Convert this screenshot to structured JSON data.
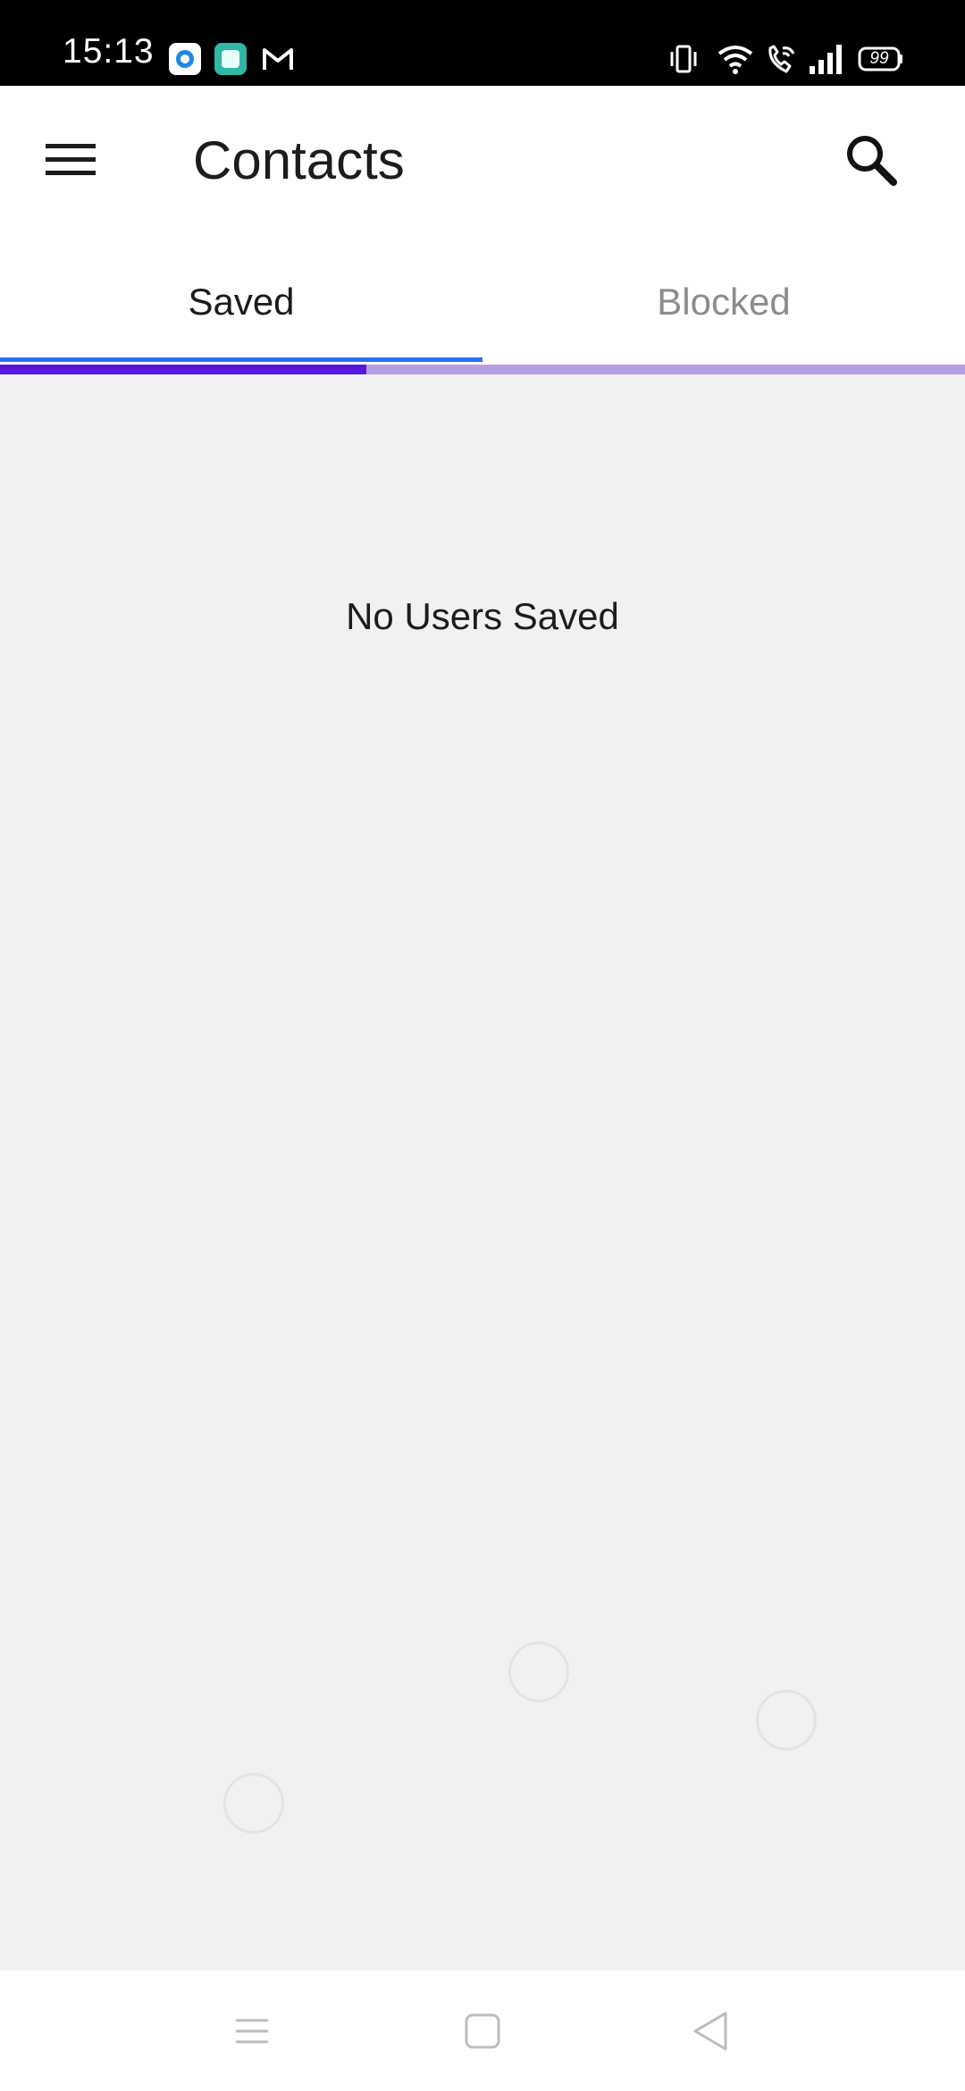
{
  "status_bar": {
    "time": "15:13",
    "battery": "99",
    "icons": [
      "app-notification-icon",
      "app-notification-icon",
      "gmail-icon",
      "vibrate-icon",
      "wifi-icon",
      "wifi-call-icon",
      "signal-icon",
      "battery-icon"
    ]
  },
  "app_bar": {
    "title": "Contacts",
    "menu_icon": "hamburger-menu-icon",
    "search_icon": "search-icon"
  },
  "tabs": [
    {
      "label": "Saved",
      "selected": true
    },
    {
      "label": "Blocked",
      "selected": false
    }
  ],
  "loading_progress": 0.38,
  "content": {
    "empty_message": "No Users Saved"
  },
  "nav_bar": {
    "icons": [
      "recents-icon",
      "home-icon",
      "back-icon"
    ]
  },
  "colors": {
    "accent": "#2a6ff0",
    "progress_fill": "#5a16e0",
    "progress_track": "#b79ce6",
    "background": "#f1f1f1",
    "inactive_tab": "#8c8c8c"
  }
}
